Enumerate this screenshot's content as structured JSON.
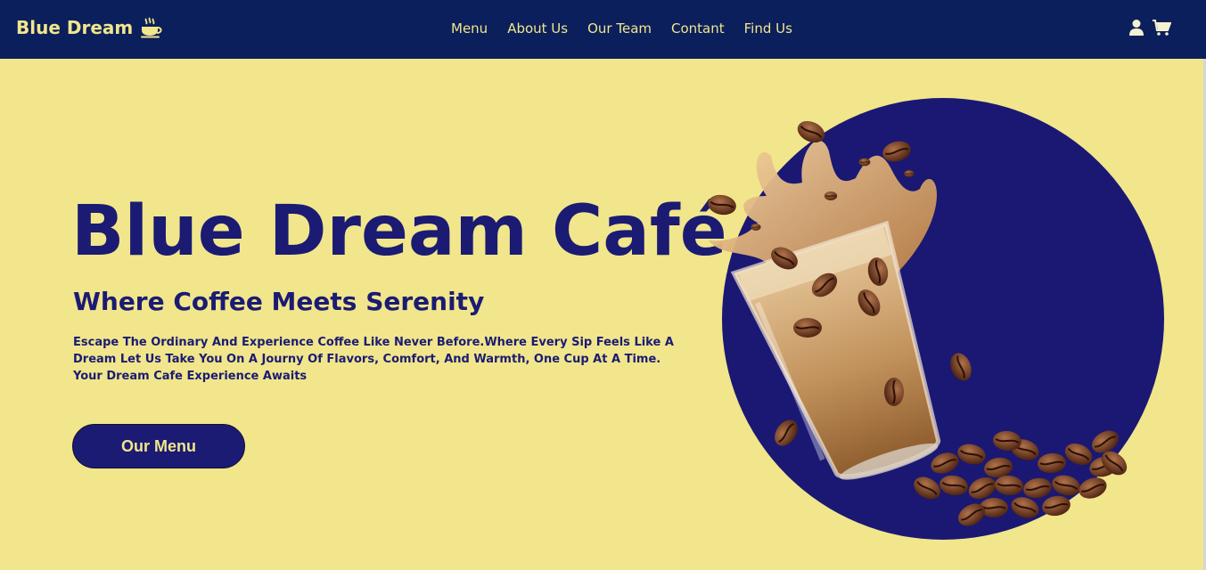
{
  "colors": {
    "navbar_bg": "#0b1f5c",
    "page_bg": "#f1e68b",
    "brand_text": "#f1e68b",
    "hero_text": "#1b1b73",
    "circle": "#1b1873",
    "button_bg": "#1b1b73"
  },
  "navbar": {
    "brand": "Blue Dream",
    "brand_icon": "coffee-cup-icon",
    "links": [
      "Menu",
      "About Us",
      "Our Team",
      "Contant",
      "Find Us"
    ],
    "icons": [
      "user-icon",
      "shopping-cart-icon"
    ]
  },
  "hero": {
    "title": "Blue Dream Café",
    "subtitle": "Where Coffee Meets Serenity",
    "description": "Escape The Ordinary And Experience Coffee Like Never Before.Where Every Sip Feels Like A Dream Let Us Take You On A Journy Of Flavors, Comfort, And Warmth, One Cup At A Time. Your Dream Cafe Experience Awaits",
    "button_label": "Our Menu",
    "image": "iced-coffee-with-coffee-beans"
  }
}
